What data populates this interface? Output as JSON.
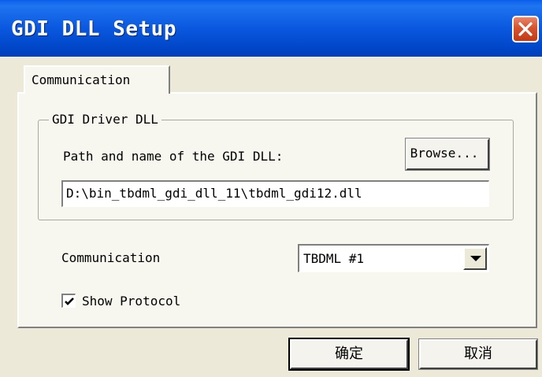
{
  "window": {
    "title": "GDI DLL Setup",
    "title_color": "#0a58df",
    "close_icon": "close-icon",
    "close_color": "#d6532f"
  },
  "tabs": [
    {
      "label": "Communication",
      "active": true
    }
  ],
  "group": {
    "title": "GDI Driver DLL",
    "path_label": "Path and name of the GDI DLL:",
    "browse_label": "Browse...",
    "dll_path": "D:\\bin_tbdml_gdi_dll_11\\tbdml_gdi12.dll"
  },
  "communication": {
    "label": "Communication",
    "selected": "TBDML #1",
    "dropdown_icon": "chevron-down-icon"
  },
  "show_protocol": {
    "label": "Show Protocol",
    "checked": true
  },
  "buttons": {
    "ok_label": "确定",
    "cancel_label": "取消"
  }
}
